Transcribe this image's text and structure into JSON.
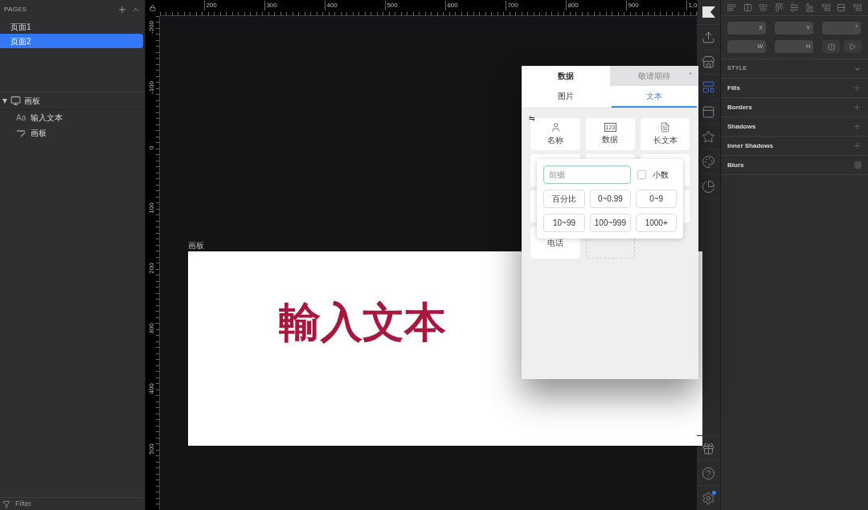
{
  "pages": {
    "title": "PAGES",
    "items": [
      {
        "label": "页面1",
        "selected": false
      },
      {
        "label": "页面2",
        "selected": true
      }
    ]
  },
  "layers": [
    {
      "label": "画板",
      "kind": "artboard",
      "expanded": true,
      "children": [
        {
          "label": "输入文本",
          "kind": "text",
          "icon_text": "Aa"
        },
        {
          "label": "画板",
          "kind": "shape"
        }
      ]
    }
  ],
  "filter": {
    "placeholder": "Filter"
  },
  "ruler": {
    "x_labels": [
      "200",
      "300",
      "400",
      "500",
      "600",
      "700",
      "800",
      "900",
      "1,0"
    ],
    "y_labels": [
      "-200",
      "-100",
      "0",
      "100",
      "200",
      "300",
      "400",
      "500"
    ]
  },
  "artboard": {
    "label": "画板",
    "text": "輸入文本"
  },
  "plugin": {
    "tabs": [
      {
        "label": "数据",
        "selected": true
      },
      {
        "label": "敬请期待",
        "selected": false,
        "arrow": "▸"
      }
    ],
    "subtabs": [
      {
        "label": "图片",
        "selected": false
      },
      {
        "label": "文本",
        "selected": true
      }
    ],
    "swap_icon": "⇋",
    "tiles": [
      {
        "label": "名称",
        "kind": "person"
      },
      {
        "label": "数据",
        "kind": "number",
        "icon_text": "123"
      },
      {
        "label": "长文本",
        "kind": "document"
      },
      {
        "kind": "hidden"
      },
      {
        "kind": "hidden"
      },
      {
        "kind": "hidden"
      },
      {
        "kind": "hidden"
      },
      {
        "kind": "hidden_end"
      },
      {
        "label": "电话",
        "kind": "plain"
      },
      {
        "kind": "dashed"
      }
    ],
    "popover": {
      "placeholder": "前缀",
      "decimal": {
        "label": "小数",
        "checked": false
      },
      "options": [
        "百分比",
        "0~0.99",
        "0~9",
        "10~99",
        "100~999",
        "1000+"
      ]
    }
  },
  "toolbar": [
    {
      "kind": "logo",
      "selected": false
    },
    {
      "kind": "export",
      "selected": false
    },
    {
      "kind": "store",
      "selected": false
    },
    {
      "kind": "layout",
      "selected": true
    },
    {
      "kind": "panel",
      "selected": false
    },
    {
      "kind": "star",
      "selected": false
    },
    {
      "kind": "palette",
      "selected": false
    },
    {
      "kind": "pie",
      "selected": false
    }
  ],
  "toolbar_bottom": [
    {
      "kind": "gift"
    },
    {
      "kind": "help"
    },
    {
      "kind": "settings",
      "badge": true
    }
  ],
  "inspector": {
    "fields": [
      [
        "X",
        "Y",
        "°"
      ],
      [
        "W",
        "H"
      ]
    ],
    "style_title": "STYLE",
    "sections": [
      {
        "label": "Fills",
        "kind": "add"
      },
      {
        "label": "Borders",
        "kind": "add"
      },
      {
        "label": "Shadows",
        "kind": "add"
      },
      {
        "label": "Inner Shadows",
        "kind": "add"
      },
      {
        "label": "Blurs",
        "kind": "toggle",
        "checked": false
      }
    ]
  }
}
